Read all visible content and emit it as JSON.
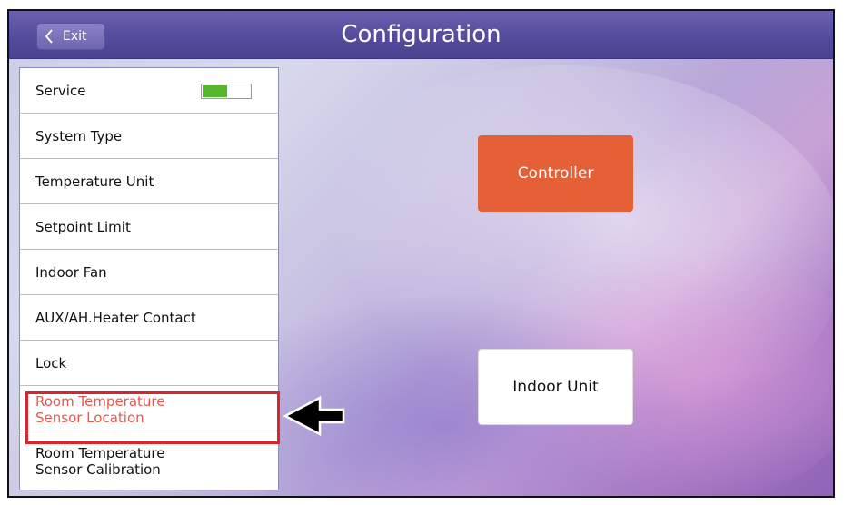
{
  "header": {
    "title": "Configuration",
    "exit_label": "Exit"
  },
  "sidebar": {
    "items": [
      {
        "label": "Service",
        "toggle": true
      },
      {
        "label": "System Type"
      },
      {
        "label": "Temperature Unit"
      },
      {
        "label": "Setpoint Limit"
      },
      {
        "label": "Indoor Fan"
      },
      {
        "label": "AUX/AH.Heater Contact"
      },
      {
        "label": "Lock"
      },
      {
        "line1": "Room Temperature",
        "line2": "Sensor Location",
        "active": true
      },
      {
        "line1": "Room Temperature",
        "line2": "Sensor Calibration"
      }
    ]
  },
  "main": {
    "controller_label": "Controller",
    "indoor_unit_label": "Indoor Unit"
  },
  "colors": {
    "header": "#544c9c",
    "controller": "#e55f37",
    "active_item": "#e8584a",
    "toggle_on": "#54b62a",
    "highlight": "#d8262c"
  },
  "icons": {
    "exit": "chevron-left-icon",
    "annotation": "arrow-left-icon"
  }
}
